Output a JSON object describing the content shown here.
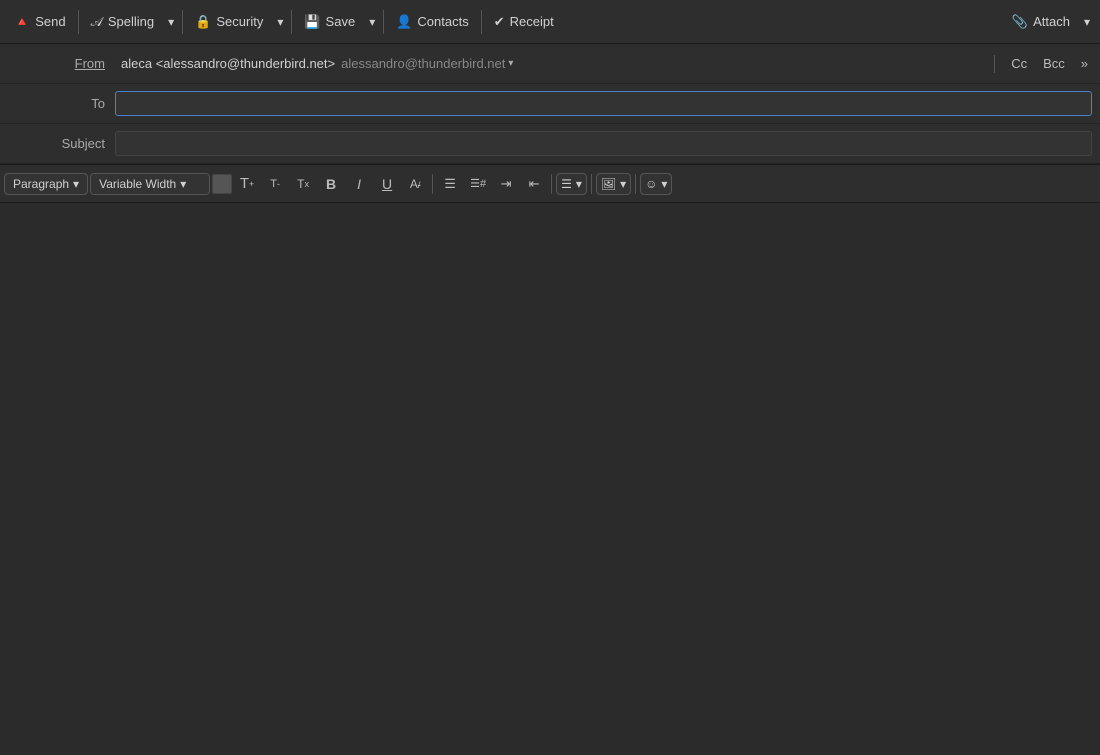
{
  "toolbar": {
    "send_label": "Send",
    "spelling_label": "Spelling",
    "security_label": "Security",
    "save_label": "Save",
    "contacts_label": "Contacts",
    "receipt_label": "Receipt",
    "attach_label": "Attach"
  },
  "header": {
    "from_label": "From",
    "to_label": "To",
    "subject_label": "Subject",
    "from_name": "aleca <alessandro@thunderbird.net>",
    "from_account": "alessandro@thunderbird.net",
    "cc_label": "Cc",
    "bcc_label": "Bcc"
  },
  "format_toolbar": {
    "paragraph_label": "Paragraph",
    "font_label": "Variable Width",
    "font_size_increase": "A+",
    "font_size_decrease": "A-",
    "font_size_reset": "Aₓ",
    "bold_label": "B",
    "italic_label": "I",
    "underline_label": "U",
    "clear_label": "A/",
    "bullet_label": "≡",
    "num_list_label": "≡#",
    "indent_label": "→",
    "outdent_label": "←",
    "align_label": "≡",
    "image_label": "⬜",
    "emoji_label": "☺"
  }
}
